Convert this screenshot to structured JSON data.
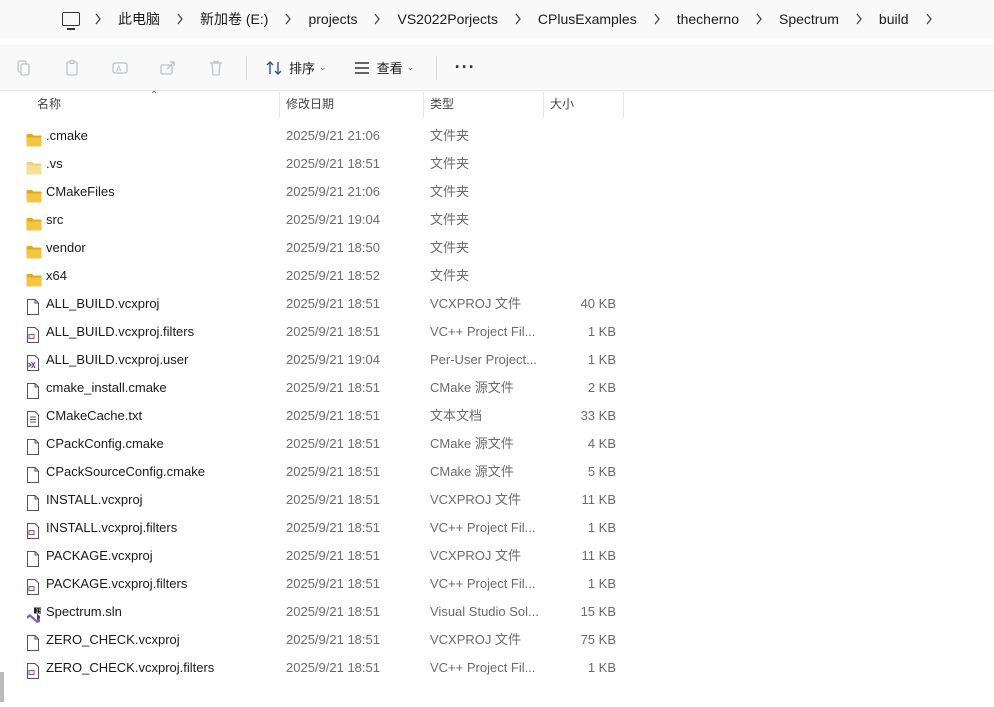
{
  "breadcrumb": [
    "此电脑",
    "新加卷 (E:)",
    "projects",
    "VS2022Porjects",
    "CPlusExamples",
    "thecherno",
    "Spectrum",
    "build"
  ],
  "toolbar": {
    "sort_label": "排序",
    "view_label": "查看",
    "more_label": "···"
  },
  "columns": {
    "name": "名称",
    "date": "修改日期",
    "type": "类型",
    "size": "大小"
  },
  "files": [
    {
      "name": ".cmake",
      "date": "2025/9/21 21:06",
      "type": "文件夹",
      "size": "",
      "icon": "folder-icon"
    },
    {
      "name": ".vs",
      "date": "2025/9/21 18:51",
      "type": "文件夹",
      "size": "",
      "icon": "folder-hidden-icon"
    },
    {
      "name": "CMakeFiles",
      "date": "2025/9/21 21:06",
      "type": "文件夹",
      "size": "",
      "icon": "folder-icon"
    },
    {
      "name": "src",
      "date": "2025/9/21 19:04",
      "type": "文件夹",
      "size": "",
      "icon": "folder-icon"
    },
    {
      "name": "vendor",
      "date": "2025/9/21 18:50",
      "type": "文件夹",
      "size": "",
      "icon": "folder-icon"
    },
    {
      "name": "x64",
      "date": "2025/9/21 18:52",
      "type": "文件夹",
      "size": "",
      "icon": "folder-icon"
    },
    {
      "name": "ALL_BUILD.vcxproj",
      "date": "2025/9/21 18:51",
      "type": "VCXPROJ 文件",
      "size": "40 KB",
      "icon": "file-icon"
    },
    {
      "name": "ALL_BUILD.vcxproj.filters",
      "date": "2025/9/21 18:51",
      "type": "VC++ Project Fil...",
      "size": "1 KB",
      "icon": "vcxproj-filters-icon"
    },
    {
      "name": "ALL_BUILD.vcxproj.user",
      "date": "2025/9/21 19:04",
      "type": "Per-User Project...",
      "size": "1 KB",
      "icon": "vs-user-icon"
    },
    {
      "name": "cmake_install.cmake",
      "date": "2025/9/21 18:51",
      "type": "CMake 源文件",
      "size": "2 KB",
      "icon": "file-icon"
    },
    {
      "name": "CMakeCache.txt",
      "date": "2025/9/21 18:51",
      "type": "文本文档",
      "size": "33 KB",
      "icon": "text-file-icon"
    },
    {
      "name": "CPackConfig.cmake",
      "date": "2025/9/21 18:51",
      "type": "CMake 源文件",
      "size": "4 KB",
      "icon": "file-icon"
    },
    {
      "name": "CPackSourceConfig.cmake",
      "date": "2025/9/21 18:51",
      "type": "CMake 源文件",
      "size": "5 KB",
      "icon": "file-icon"
    },
    {
      "name": "INSTALL.vcxproj",
      "date": "2025/9/21 18:51",
      "type": "VCXPROJ 文件",
      "size": "11 KB",
      "icon": "file-icon"
    },
    {
      "name": "INSTALL.vcxproj.filters",
      "date": "2025/9/21 18:51",
      "type": "VC++ Project Fil...",
      "size": "1 KB",
      "icon": "vcxproj-filters-icon"
    },
    {
      "name": "PACKAGE.vcxproj",
      "date": "2025/9/21 18:51",
      "type": "VCXPROJ 文件",
      "size": "11 KB",
      "icon": "file-icon"
    },
    {
      "name": "PACKAGE.vcxproj.filters",
      "date": "2025/9/21 18:51",
      "type": "VC++ Project Fil...",
      "size": "1 KB",
      "icon": "vcxproj-filters-icon"
    },
    {
      "name": "Spectrum.sln",
      "date": "2025/9/21 18:51",
      "type": "Visual Studio Sol...",
      "size": "15 KB",
      "icon": "vs-solution-icon"
    },
    {
      "name": "ZERO_CHECK.vcxproj",
      "date": "2025/9/21 18:51",
      "type": "VCXPROJ 文件",
      "size": "75 KB",
      "icon": "file-icon"
    },
    {
      "name": "ZERO_CHECK.vcxproj.filters",
      "date": "2025/9/21 18:51",
      "type": "VC++ Project Fil...",
      "size": "1 KB",
      "icon": "vcxproj-filters-icon"
    }
  ],
  "colors": {
    "folder": "#f4c542",
    "folder_dark": "#e6a817",
    "filters_purple": "#8b4a9c"
  }
}
